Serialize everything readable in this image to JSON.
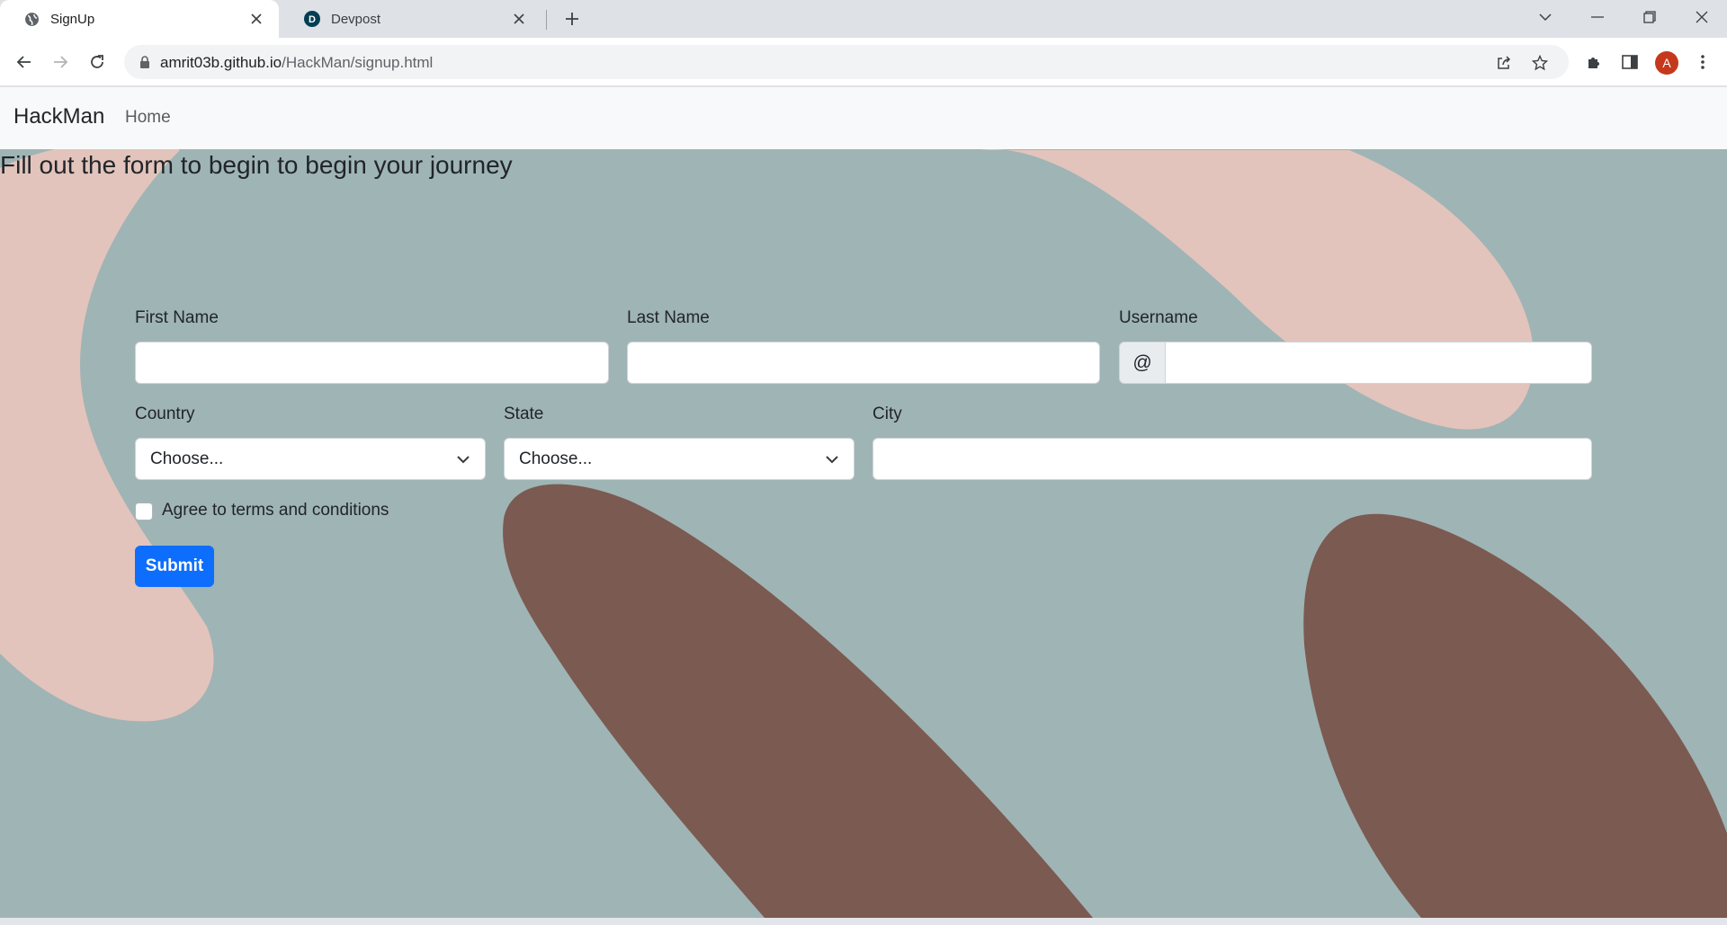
{
  "browser": {
    "tabs": [
      {
        "title": "SignUp",
        "icon": "globe-icon",
        "active": true
      },
      {
        "title": "Devpost",
        "icon": "devpost-logo-icon",
        "active": false
      }
    ],
    "url_host": "amrit03b.github.io",
    "url_path": "/HackMan/signup.html",
    "profile_initial": "A",
    "profile_color": "#c5381b"
  },
  "navbar": {
    "brand": "HackMan",
    "links": [
      "Home"
    ]
  },
  "page": {
    "heading": "Fill out the form to begin to begin your journey",
    "background_color": "#9fb4b5",
    "shape_colors": {
      "pink": "#e2c4bc",
      "brown": "#7b5a51"
    }
  },
  "form": {
    "first_name_label": "First Name",
    "first_name_value": "",
    "last_name_label": "Last Name",
    "last_name_value": "",
    "username_label": "Username",
    "username_prefix": "@",
    "username_value": "",
    "country_label": "Country",
    "country_selected": "Choose...",
    "state_label": "State",
    "state_selected": "Choose...",
    "city_label": "City",
    "city_value": "",
    "terms_label": "Agree to terms and conditions",
    "terms_checked": false,
    "submit_label": "Submit",
    "submit_color": "#0d6efd"
  }
}
